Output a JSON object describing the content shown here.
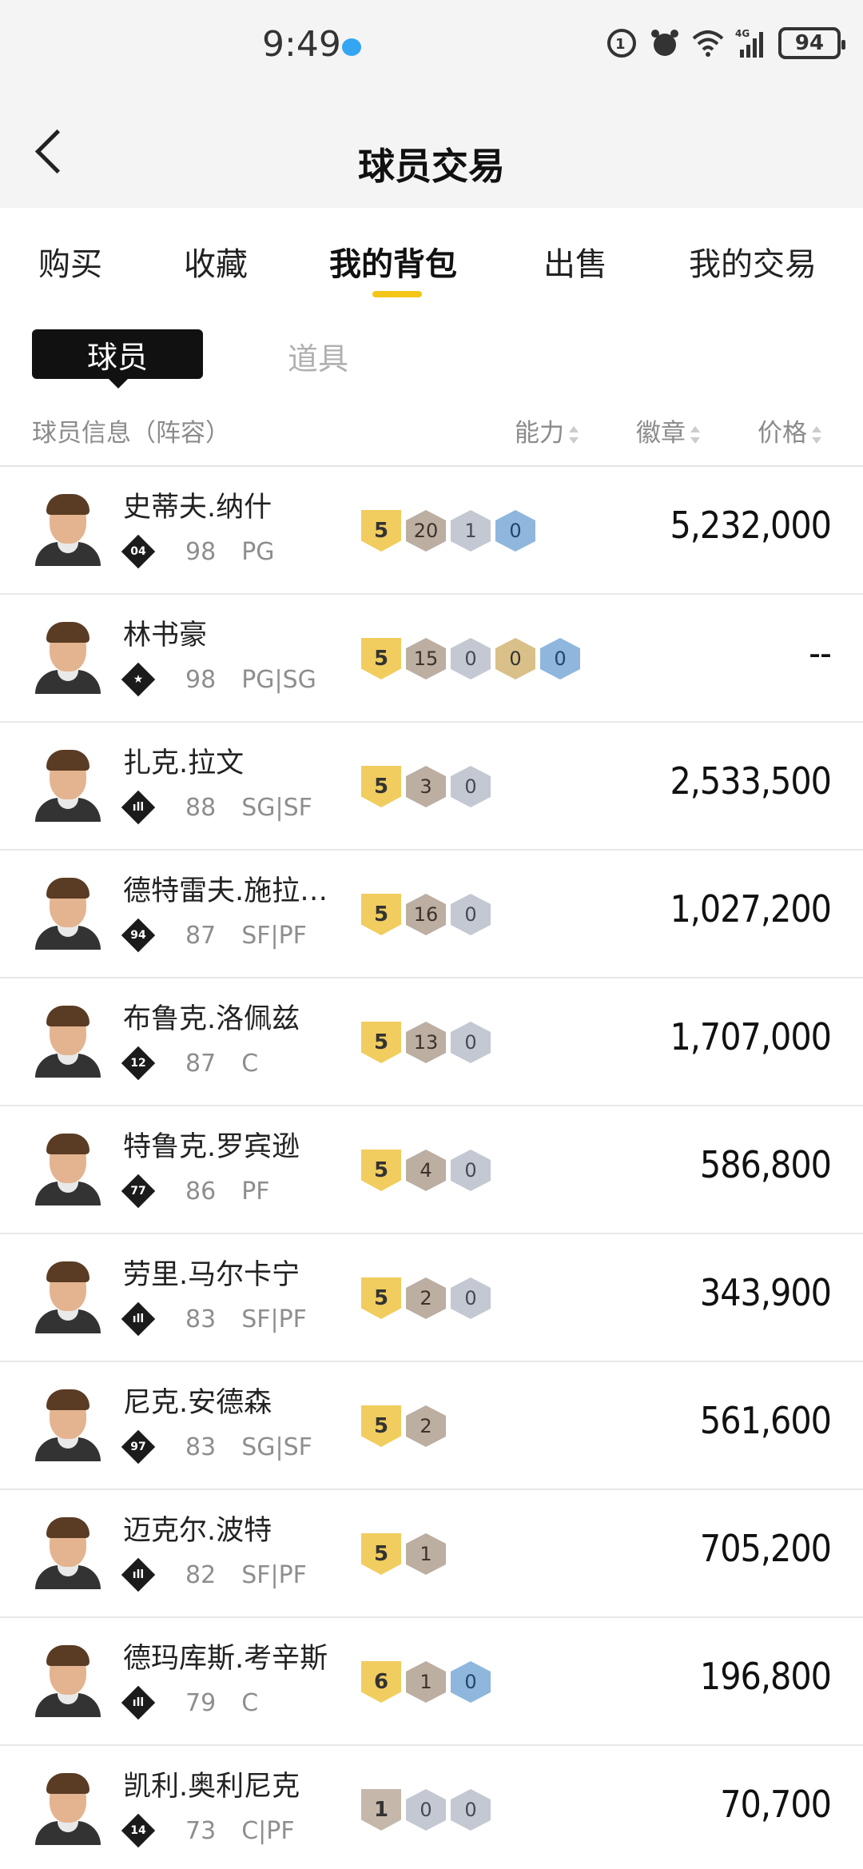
{
  "status": {
    "time": "9:49",
    "battery": "94"
  },
  "header": {
    "title": "球员交易"
  },
  "tabs": [
    "购买",
    "收藏",
    "我的背包",
    "出售",
    "我的交易"
  ],
  "segments": {
    "active": "球员",
    "inactive": "道具"
  },
  "columns": {
    "info": "球员信息（阵容）",
    "ability": "能力",
    "badge": "徽章",
    "price": "价格"
  },
  "players": [
    {
      "name": "史蒂夫.纳什",
      "num": "04",
      "ovr": "98",
      "pos": "PG",
      "level": "5",
      "badges": [
        {
          "n": "20",
          "t": "bronze"
        },
        {
          "n": "1",
          "t": "silver"
        },
        {
          "n": "0",
          "t": "hof"
        }
      ],
      "price": "5,232,000"
    },
    {
      "name": "林书豪",
      "num": "★",
      "ovr": "98",
      "pos": "PG|SG",
      "level": "5",
      "badges": [
        {
          "n": "15",
          "t": "bronze"
        },
        {
          "n": "0",
          "t": "silver"
        },
        {
          "n": "0",
          "t": "gold"
        },
        {
          "n": "0",
          "t": "hof"
        }
      ],
      "price": "--"
    },
    {
      "name": "扎克.拉文",
      "num": "ıll",
      "ovr": "88",
      "pos": "SG|SF",
      "level": "5",
      "badges": [
        {
          "n": "3",
          "t": "bronze"
        },
        {
          "n": "0",
          "t": "silver"
        }
      ],
      "price": "2,533,500"
    },
    {
      "name": "德特雷夫.施拉…",
      "num": "94",
      "ovr": "87",
      "pos": "SF|PF",
      "level": "5",
      "badges": [
        {
          "n": "16",
          "t": "bronze"
        },
        {
          "n": "0",
          "t": "silver"
        }
      ],
      "price": "1,027,200"
    },
    {
      "name": "布鲁克.洛佩兹",
      "num": "12",
      "ovr": "87",
      "pos": "C",
      "level": "5",
      "badges": [
        {
          "n": "13",
          "t": "bronze"
        },
        {
          "n": "0",
          "t": "silver"
        }
      ],
      "price": "1,707,000"
    },
    {
      "name": "特鲁克.罗宾逊",
      "num": "77",
      "ovr": "86",
      "pos": "PF",
      "level": "5",
      "badges": [
        {
          "n": "4",
          "t": "bronze"
        },
        {
          "n": "0",
          "t": "silver"
        }
      ],
      "price": "586,800"
    },
    {
      "name": "劳里.马尔卡宁",
      "num": "ıll",
      "ovr": "83",
      "pos": "SF|PF",
      "level": "5",
      "badges": [
        {
          "n": "2",
          "t": "bronze"
        },
        {
          "n": "0",
          "t": "silver"
        }
      ],
      "price": "343,900"
    },
    {
      "name": "尼克.安德森",
      "num": "97",
      "ovr": "83",
      "pos": "SG|SF",
      "level": "5",
      "badges": [
        {
          "n": "2",
          "t": "bronze"
        }
      ],
      "price": "561,600"
    },
    {
      "name": "迈克尔.波特",
      "num": "ıll",
      "ovr": "82",
      "pos": "SF|PF",
      "level": "5",
      "badges": [
        {
          "n": "1",
          "t": "bronze"
        }
      ],
      "price": "705,200"
    },
    {
      "name": "德玛库斯.考辛斯",
      "num": "ıll",
      "ovr": "79",
      "pos": "C",
      "level": "6",
      "badges": [
        {
          "n": "1",
          "t": "bronze"
        },
        {
          "n": "0",
          "t": "hof"
        }
      ],
      "price": "196,800"
    },
    {
      "name": "凯利.奥利尼克",
      "num": "14",
      "ovr": "73",
      "pos": "C|PF",
      "level": "1",
      "levelGrey": true,
      "badges": [
        {
          "n": "0",
          "t": "silver"
        },
        {
          "n": "0",
          "t": "silver"
        }
      ],
      "price": "70,700"
    }
  ],
  "colors": {
    "accent": "#f4c619",
    "level": "#f1cd5f",
    "bronze": "#bcaea1",
    "silver": "#c4c8d2",
    "gold": "#d9c089",
    "hof": "#8fb7dd"
  }
}
